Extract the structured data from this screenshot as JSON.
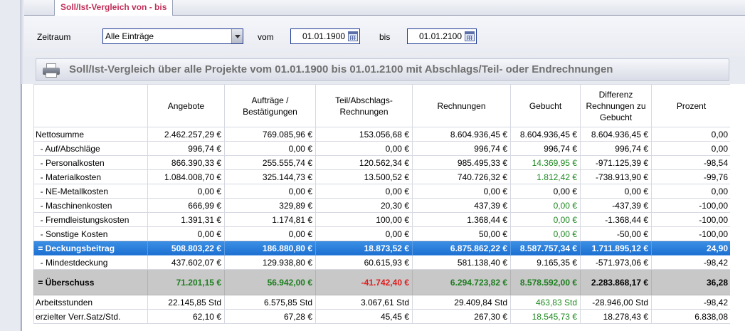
{
  "tab": {
    "label": "Soll/Ist-Vergleich von - bis"
  },
  "filter": {
    "zeitraum_label": "Zeitraum",
    "zeitraum_value": "Alle Einträge",
    "vom_label": "vom",
    "vom_value": "01.01.1900",
    "bis_label": "bis",
    "bis_value": "01.01.2100"
  },
  "heading": "Soll/Ist-Vergleich über alle Projekte vom 01.01.1900 bis 01.01.2100 mit Abschlags/Teil- oder Endrechnungen",
  "columns": [
    "Angebote",
    "Aufträge / Bestätigungen",
    "Teil/Abschlags-Rechnungen",
    "Rechnungen",
    "Gebucht",
    "Differenz Rechnungen zu Gebucht",
    "Prozent"
  ],
  "rows": [
    {
      "label": "Nettosumme",
      "cells": [
        "2.462.257,29 €",
        "769.085,96 €",
        "153.056,68 €",
        "8.604.936,45 €",
        "8.604.936,45 €",
        "8.604.936,45 €",
        "0,00"
      ]
    },
    {
      "label": "  - Auf/Abschläge",
      "cells": [
        "996,74 €",
        "0,00 €",
        "0,00 €",
        "996,74 €",
        "996,74 €",
        "996,74 €",
        "0,00"
      ]
    },
    {
      "label": "  - Personalkosten",
      "cells": [
        "866.390,33 €",
        "255.555,74 €",
        "120.562,34 €",
        "985.495,33 €",
        "14.369,95 €",
        "-971.125,39 €",
        "-98,54"
      ]
    },
    {
      "label": "  - Materialkosten",
      "cells": [
        "1.084.008,70 €",
        "325.144,73 €",
        "13.500,52 €",
        "740.726,32 €",
        "1.812,42 €",
        "-738.913,90 €",
        "-99,76"
      ]
    },
    {
      "label": "  - NE-Metallkosten",
      "cells": [
        "0,00 €",
        "0,00 €",
        "0,00 €",
        "0,00 €",
        "0,00 €",
        "0,00 €",
        "0,00"
      ]
    },
    {
      "label": "  - Maschinenkosten",
      "cells": [
        "666,99 €",
        "329,89 €",
        "20,30 €",
        "437,39 €",
        "0,00 €",
        "-437,39 €",
        "-100,00"
      ]
    },
    {
      "label": "  - Fremdleistungskosten",
      "cells": [
        "1.391,31 €",
        "1.174,81 €",
        "100,00 €",
        "1.368,44 €",
        "0,00 €",
        "-1.368,44 €",
        "-100,00"
      ]
    },
    {
      "label": "  - Sonstige Kosten",
      "cells": [
        "0,00 €",
        "0,00 €",
        "0,00 €",
        "50,00 €",
        "0,00 €",
        "-50,00 €",
        "-100,00"
      ]
    },
    {
      "label": " = Deckungsbeitrag",
      "cells": [
        "508.803,22 €",
        "186.880,80 €",
        "18.873,52 €",
        "6.875.862,22 €",
        "8.587.757,34 €",
        "1.711.895,12 €",
        "24,90"
      ]
    },
    {
      "label": "  - Mindestdeckung",
      "cells": [
        "437.602,07 €",
        "129.938,80 €",
        "60.615,93 €",
        "581.138,40 €",
        "9.165,35 €",
        "-571.973,06 €",
        "-98,42"
      ]
    },
    {
      "label": " = Überschuss",
      "cells": [
        "71.201,15 €",
        "56.942,00 €",
        "-41.742,40 €",
        "6.294.723,82 €",
        "8.578.592,00 €",
        "2.283.868,17 €",
        "36,28"
      ]
    },
    {
      "label": "Arbeitsstunden",
      "cells": [
        "22.145,85 Std",
        "6.575,85 Std",
        "3.067,61 Std",
        "29.409,84 Std",
        "463,83 Std",
        "-28.946,00 Std",
        "-98,42"
      ]
    },
    {
      "label": "erzielter Verr.Satz/Std.",
      "cells": [
        "62,10 €",
        "67,28 €",
        "45,45 €",
        "267,30 €",
        "18.545,73 €",
        "18.278,43 €",
        "6.838,08"
      ]
    }
  ],
  "colors": {
    "accent_tab": "#c0305a",
    "highlight_row": "#1c6fd1",
    "positive": "#1f8a22",
    "negative": "#e01c1c"
  }
}
